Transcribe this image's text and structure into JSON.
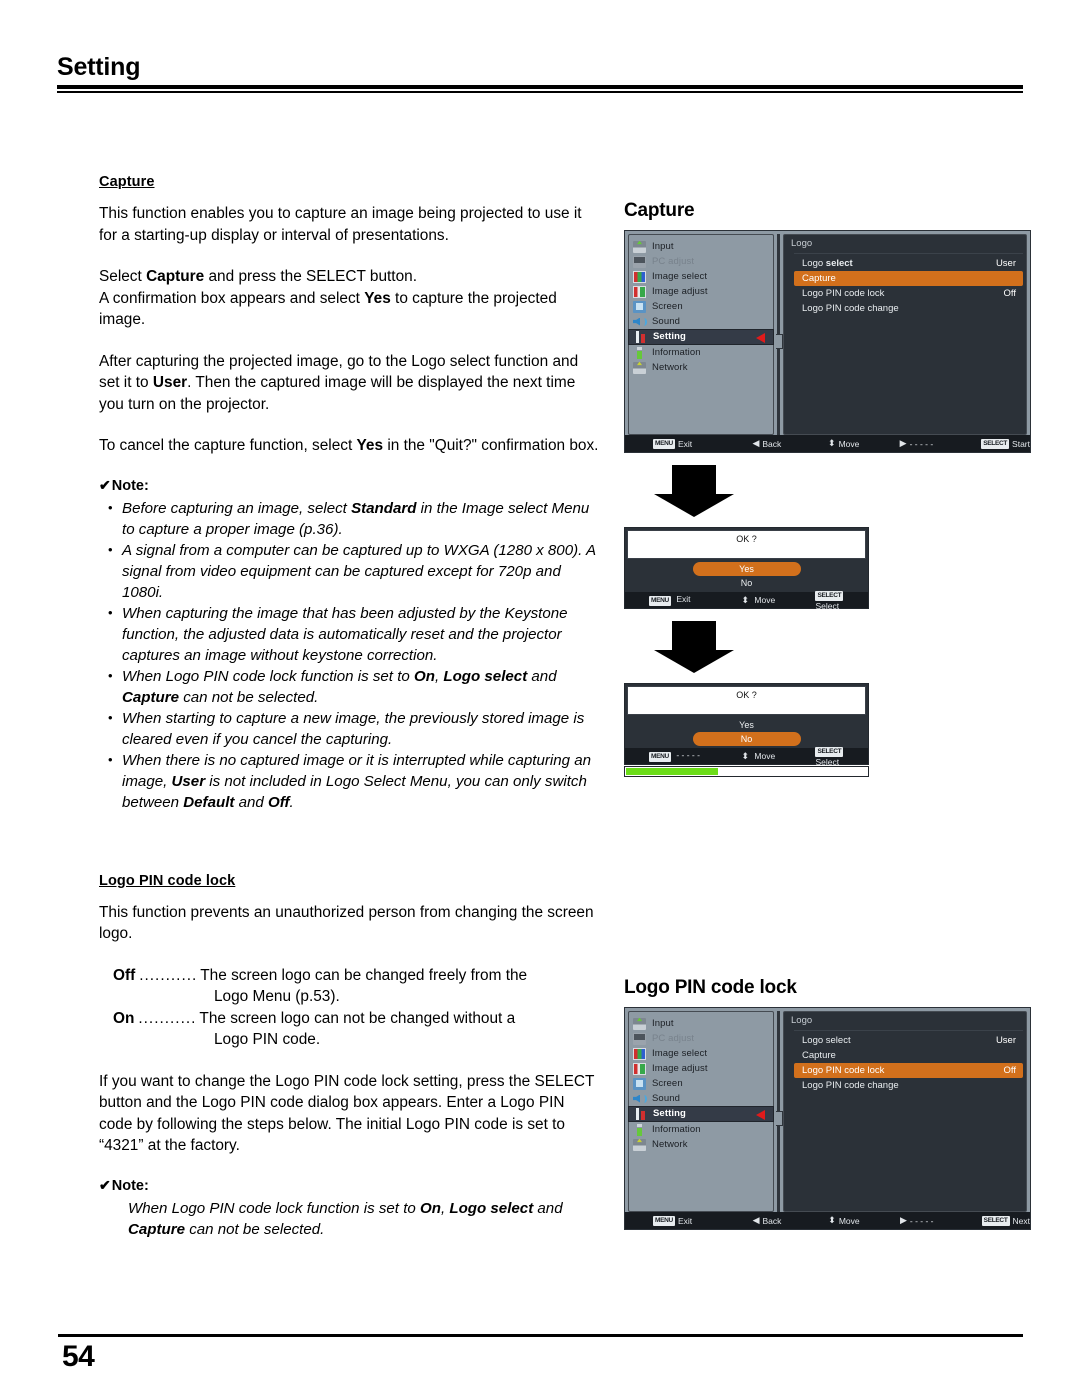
{
  "header": {
    "title": "Setting"
  },
  "page_number": "54",
  "left_column": {
    "capture_section": {
      "heading": "Capture",
      "paragraphs": [
        "This function enables you to capture an image being projected to use it for a starting-up display or interval of presentations.",
        "Select Capture and press the SELECT button. A confirmation box appears and select Yes to capture the projected image.",
        "After capturing the projected image, go to the Logo select function and set it to User. Then the captured image will be displayed the next time you turn on the projector.",
        "To cancel the capture function, select Yes in the \"Quit?\" confirmation box."
      ],
      "note_label": "Note:",
      "note_check_glyph": "✔",
      "notes": [
        "Before capturing an image, select Standard in the Image select Menu to capture a proper image (p.36).",
        "A signal from a computer can be captured up to WXGA (1280 x 800). A signal from video equipment can be captured except for 720p and 1080i.",
        "When capturing the image that has been adjusted by the Keystone function, the adjusted data is automatically reset and the projector captures an image without keystone correction.",
        "When Logo PIN code lock function is set to On, Logo select and Capture can not be selected.",
        "When starting to capture a new image, the previously stored image is cleared even if you cancel the capturing.",
        "When there is no captured image or it is interrupted while capturing an image, User is not included in Logo Select Menu, you can only switch between Default and Off."
      ]
    },
    "logo_pin_section": {
      "heading": "Logo PIN code lock",
      "intro": "This function prevents an unauthorized person from changing the screen logo.",
      "definitions": [
        {
          "term": "Off",
          "dots": "...........",
          "desc": "The screen logo can be changed freely from the",
          "desc_cont": "Logo Menu (p.53)."
        },
        {
          "term": "On",
          "dots": "...........",
          "desc": "The screen logo can not be changed without a",
          "desc_cont": "Logo PIN code."
        }
      ],
      "paragraph": "If you want to change the Logo PIN code lock setting, press the SELECT button and the Logo PIN code dialog box appears. Enter a Logo PIN code by following the steps below. The initial Logo PIN code is set to “4321” at the factory.",
      "note_label": "Note:",
      "note_check_glyph": "✔",
      "note_text": "When Logo PIN code lock function is set to On, Logo select and Capture can not be selected."
    }
  },
  "right_column": {
    "capture_figure": {
      "title": "Capture",
      "menu": {
        "sidebar_items": [
          {
            "label": "Input",
            "icon": "input-icon",
            "state": "normal"
          },
          {
            "label": "PC adjust",
            "icon": "pc-adjust-icon",
            "state": "dim"
          },
          {
            "label": "Image select",
            "icon": "image-select-icon",
            "state": "normal"
          },
          {
            "label": "Image adjust",
            "icon": "image-adjust-icon",
            "state": "normal"
          },
          {
            "label": "Screen",
            "icon": "screen-icon",
            "state": "normal"
          },
          {
            "label": "Sound",
            "icon": "sound-icon",
            "state": "normal"
          },
          {
            "label": "Setting",
            "icon": "setting-icon",
            "state": "selected"
          },
          {
            "label": "Information",
            "icon": "information-icon",
            "state": "normal"
          },
          {
            "label": "Network",
            "icon": "network-icon",
            "state": "normal"
          }
        ],
        "panel_title": "Logo",
        "options": [
          {
            "label": "Logo select",
            "value": "User",
            "highlighted": false
          },
          {
            "label": "Capture",
            "value": "",
            "highlighted": true
          },
          {
            "label": "Logo PIN code lock",
            "value": "Off",
            "highlighted": false
          },
          {
            "label": "Logo PIN code change",
            "value": "",
            "highlighted": false
          }
        ],
        "footer": [
          {
            "badge": "MENU",
            "glyph": "",
            "label": "Exit"
          },
          {
            "badge": "",
            "glyph": "◀",
            "label": "Back"
          },
          {
            "badge": "",
            "glyph": "⬍",
            "label": "Move"
          },
          {
            "badge": "",
            "glyph": "▶",
            "label": "- - - - -"
          },
          {
            "badge": "SELECT",
            "glyph": "",
            "label": "Start"
          }
        ]
      }
    },
    "dialog_yes": {
      "message": "OK ?",
      "options": [
        {
          "label": "Yes",
          "highlighted": true
        },
        {
          "label": "No",
          "highlighted": false
        }
      ],
      "footer": [
        {
          "badge": "MENU",
          "glyph": "",
          "label": "Exit"
        },
        {
          "badge": "",
          "glyph": "⬍",
          "label": "Move"
        },
        {
          "badge": "SELECT",
          "glyph": "",
          "label": "Select"
        }
      ],
      "has_progress": false
    },
    "dialog_no": {
      "message": "OK ?",
      "options": [
        {
          "label": "Yes",
          "highlighted": false
        },
        {
          "label": "No",
          "highlighted": true
        }
      ],
      "footer": [
        {
          "badge": "MENU",
          "glyph": "",
          "label": "- - - - -"
        },
        {
          "badge": "",
          "glyph": "⬍",
          "label": "Move"
        },
        {
          "badge": "SELECT",
          "glyph": "",
          "label": "Select"
        }
      ],
      "has_progress": true,
      "progress_percent": 38
    },
    "logo_pin_figure": {
      "title": "Logo PIN code lock",
      "menu": {
        "sidebar_items": [
          {
            "label": "Input",
            "icon": "input-icon",
            "state": "normal"
          },
          {
            "label": "PC adjust",
            "icon": "pc-adjust-icon",
            "state": "dim"
          },
          {
            "label": "Image select",
            "icon": "image-select-icon",
            "state": "normal"
          },
          {
            "label": "Image adjust",
            "icon": "image-adjust-icon",
            "state": "normal"
          },
          {
            "label": "Screen",
            "icon": "screen-icon",
            "state": "normal"
          },
          {
            "label": "Sound",
            "icon": "sound-icon",
            "state": "normal"
          },
          {
            "label": "Setting",
            "icon": "setting-icon",
            "state": "selected"
          },
          {
            "label": "Information",
            "icon": "information-icon",
            "state": "normal"
          },
          {
            "label": "Network",
            "icon": "network-icon",
            "state": "normal"
          }
        ],
        "panel_title": "Logo",
        "options": [
          {
            "label": "Logo select",
            "value": "User",
            "highlighted": false
          },
          {
            "label": "Capture",
            "value": "",
            "highlighted": false
          },
          {
            "label": "Logo PIN code lock",
            "value": "Off",
            "highlighted": true
          },
          {
            "label": "Logo PIN code change",
            "value": "",
            "highlighted": false
          }
        ],
        "footer": [
          {
            "badge": "MENU",
            "glyph": "",
            "label": "Exit"
          },
          {
            "badge": "",
            "glyph": "◀",
            "label": "Back"
          },
          {
            "badge": "",
            "glyph": "⬍",
            "label": "Move"
          },
          {
            "badge": "",
            "glyph": "▶",
            "label": "- - - - -"
          },
          {
            "badge": "SELECT",
            "glyph": "",
            "label": "Next"
          }
        ]
      }
    }
  },
  "colors": {
    "highlight_orange": "#d2701c",
    "osd_panel_dark": "#2b3138",
    "osd_sidebar_gray": "#8e9aa4",
    "osd_footer_black": "#171b20",
    "selected_row": "#343b47",
    "arrow_red": "#e01b1b",
    "progress_green": "#6cdd18"
  }
}
